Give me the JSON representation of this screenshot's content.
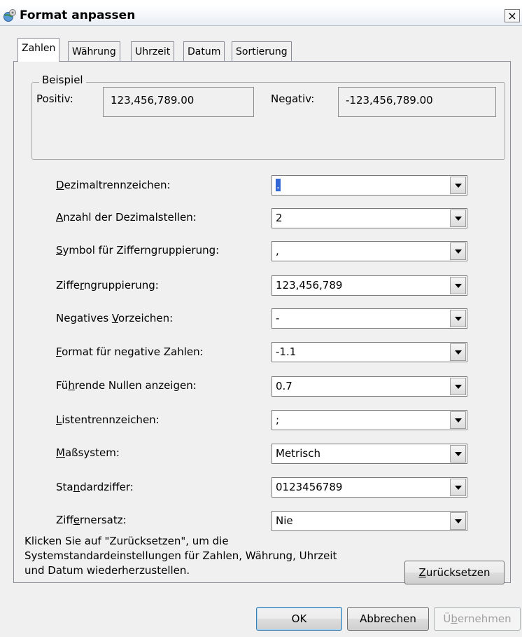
{
  "window": {
    "title": "Format anpassen",
    "close_glyph": "×"
  },
  "tabs": [
    {
      "label": "Zahlen",
      "active": true
    },
    {
      "label": "Währung",
      "active": false
    },
    {
      "label": "Uhrzeit",
      "active": false
    },
    {
      "label": "Datum",
      "active": false
    },
    {
      "label": "Sortierung",
      "active": false
    }
  ],
  "sample": {
    "legend": "Beispiel",
    "positive_label": "Positiv:",
    "positive_value": "123,456,789.00",
    "negative_label": "Negativ:",
    "negative_value": "-123,456,789.00"
  },
  "rows": [
    {
      "pre": "",
      "key": "D",
      "post": "ezimaltrennzeichen:",
      "value": "."
    },
    {
      "pre": "",
      "key": "A",
      "post": "nzahl der Dezimalstellen:",
      "value": "2"
    },
    {
      "pre": "",
      "key": "S",
      "post": "ymbol für Zifferngruppierung:",
      "value": ","
    },
    {
      "pre": "Ziffe",
      "key": "r",
      "post": "ngruppierung:",
      "value": "123,456,789"
    },
    {
      "pre": "Negatives ",
      "key": "V",
      "post": "orzeichen:",
      "value": "-"
    },
    {
      "pre": "",
      "key": "F",
      "post": "ormat für negative Zahlen:",
      "value": "-1.1"
    },
    {
      "pre": "Fü",
      "key": "h",
      "post": "rende Nullen anzeigen:",
      "value": "0.7"
    },
    {
      "pre": "",
      "key": "L",
      "post": "istentrennzeichen:",
      "value": ";"
    },
    {
      "pre": "",
      "key": "M",
      "post": "aßsystem:",
      "value": "Metrisch"
    },
    {
      "pre": "Sta",
      "key": "n",
      "post": "dardziffer:",
      "value": "0123456789"
    },
    {
      "pre": "Ziff",
      "key": "e",
      "post": "rnersatz:",
      "value": "Nie"
    }
  ],
  "info": {
    "line1": "Klicken Sie auf \"Zurücksetzen\", um die",
    "line2": "Systemstandardeinstellungen für Zahlen, Währung, Uhrzeit",
    "line3": "und Datum wiederherzustellen."
  },
  "buttons": {
    "reset": {
      "key": "Z",
      "rest": "urücksetzen"
    },
    "ok": "OK",
    "cancel": "Abbrechen",
    "apply": {
      "pre": "Ü",
      "key": "b",
      "rest": "ernehmen"
    }
  },
  "colors": {
    "selection": "#3367d6",
    "disabled_text": "#a0a0a0"
  }
}
